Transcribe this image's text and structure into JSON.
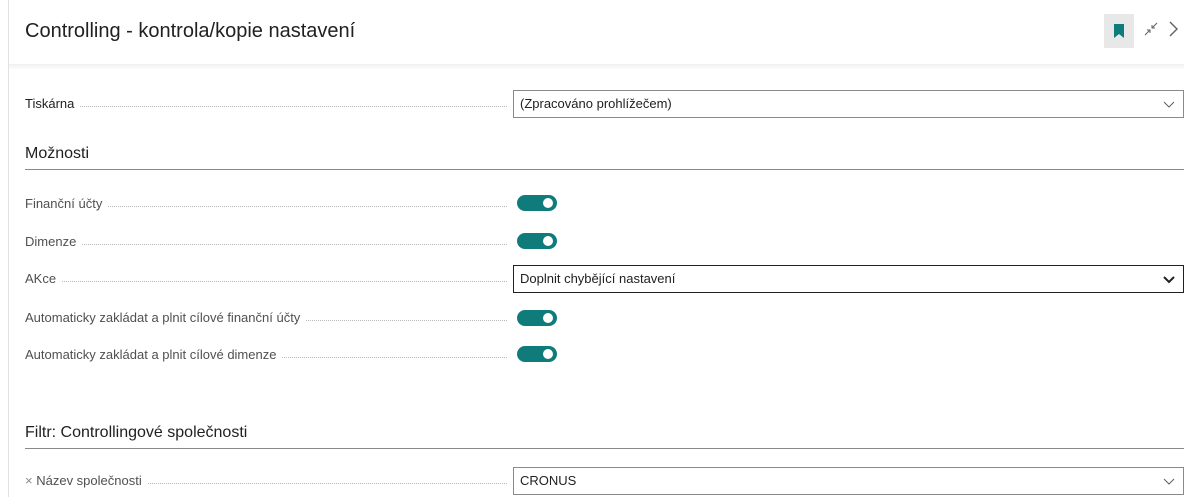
{
  "header": {
    "title": "Controlling - kontrola/kopie nastavení"
  },
  "printer": {
    "label": "Tiskárna",
    "value": "(Zpracováno prohlížečem)"
  },
  "options": {
    "heading": "Možnosti",
    "financial_accounts": {
      "label": "Finanční účty",
      "on": true
    },
    "dimensions": {
      "label": "Dimenze",
      "on": true
    },
    "action": {
      "label": "AKce",
      "value": "Doplnit chybějící nastavení"
    },
    "auto_accounts": {
      "label": "Automaticky zakládat a plnit cílové finanční účty",
      "on": true
    },
    "auto_dimensions": {
      "label": "Automaticky zakládat a plnit cílové dimenze",
      "on": true
    }
  },
  "filter": {
    "heading": "Filtr: Controllingové společnosti",
    "company_name": {
      "label": "Název společnosti",
      "value": "CRONUS"
    }
  },
  "colors": {
    "accent": "#0f7b7b"
  }
}
